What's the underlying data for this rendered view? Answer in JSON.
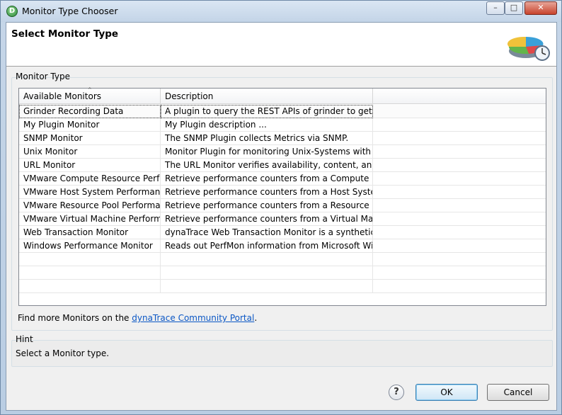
{
  "window": {
    "title": "Monitor Type Chooser",
    "app_icon": "dynatrace-icon",
    "controls": {
      "minimize_icon": "minimize-icon",
      "maximize_icon": "maximize-icon",
      "close_icon": "close-icon"
    }
  },
  "header": {
    "title": "Select Monitor Type",
    "graphic_icon": "pie-chart-clock-icon"
  },
  "monitor_group": {
    "label": "Monitor Type",
    "table": {
      "columns": [
        "Available Monitors",
        "Description",
        ""
      ],
      "sort_icon": "sort-ascending-icon",
      "selected_index": 0,
      "rows": [
        {
          "name": "Grinder Recording Data",
          "description": "A plugin to query the REST APIs of grinder to get exe..."
        },
        {
          "name": "My Plugin Monitor",
          "description": "My Plugin description ..."
        },
        {
          "name": "SNMP Monitor",
          "description": "The SNMP Plugin collects Metrics via SNMP."
        },
        {
          "name": "Unix Monitor",
          "description": "Monitor Plugin for monitoring Unix-Systems with co..."
        },
        {
          "name": "URL Monitor",
          "description": "The URL Monitor verifies availability, content, and ac..."
        },
        {
          "name": "VMware Compute Resource Perfo...",
          "description": "Retrieve performance counters from a Compute Res..."
        },
        {
          "name": "VMware Host System Performanc...",
          "description": "Retrieve performance counters from a Host System ..."
        },
        {
          "name": "VMware Resource Pool Performan...",
          "description": "Retrieve performance counters from a Resource Poo..."
        },
        {
          "name": "VMware Virtual Machine Performa...",
          "description": "Retrieve performance counters from a Virtual Machi..."
        },
        {
          "name": "Web Transaction Monitor",
          "description": "dynaTrace Web Transaction Monitor is a synthetic ..."
        },
        {
          "name": "Windows Performance Monitor",
          "description": "Reads out PerfMon information from Microsoft Win..."
        },
        {
          "name": "",
          "description": ""
        },
        {
          "name": "",
          "description": ""
        },
        {
          "name": "",
          "description": ""
        }
      ]
    },
    "footer_prefix": "Find more Monitors on the ",
    "footer_link": "dynaTrace Community Portal",
    "footer_suffix": "."
  },
  "hint": {
    "label": "Hint",
    "text": "Select a Monitor type."
  },
  "buttons": {
    "help_icon": "help-icon",
    "help_glyph": "?",
    "ok": "OK",
    "cancel": "Cancel"
  },
  "colors": {
    "link": "#0b57c5",
    "ok_button_border": "#3c7fb1"
  }
}
